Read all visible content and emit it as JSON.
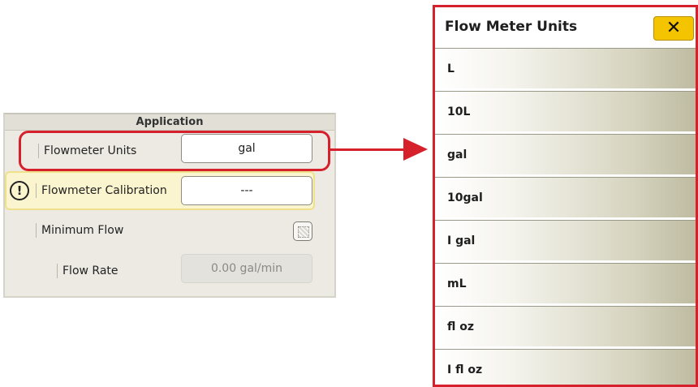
{
  "application_panel": {
    "title": "Application",
    "rows": [
      {
        "label": "Flowmeter Units",
        "value": "gal"
      },
      {
        "label": "Flowmeter Calibration",
        "value": "---",
        "warning": true
      },
      {
        "label": "Minimum Flow"
      },
      {
        "label": "Flow Rate",
        "value": "0.00 gal/min",
        "disabled": true
      }
    ],
    "warning_glyph": "!"
  },
  "flow_meter_dialog": {
    "title": "Flow Meter Units",
    "close_glyph": "✕",
    "options": [
      "L",
      "10L",
      "gal",
      "10gal",
      "I gal",
      "mL",
      "fl oz",
      "I fl oz"
    ]
  },
  "colors": {
    "highlight": "#d6202b",
    "close_button": "#f4c400",
    "warning_bg": "#fbf5cf"
  },
  "icons": {
    "warning": "warning-icon",
    "checkbox": "checkbox-icon",
    "close": "close-icon",
    "arrow": "arrow-right-icon"
  }
}
